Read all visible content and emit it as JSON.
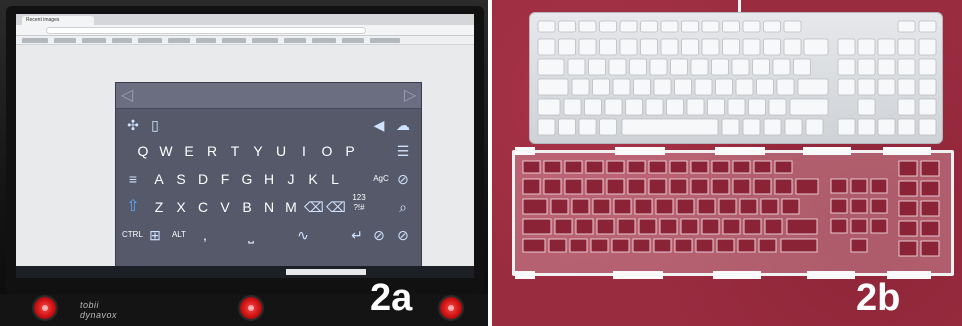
{
  "panels": [
    {
      "label": "2a",
      "browser": {
        "tab_title": "Recent images"
      },
      "keyboard": {
        "rows": [
          [
            "Q",
            "W",
            "E",
            "R",
            "T",
            "Y",
            "U",
            "I",
            "O",
            "P"
          ],
          [
            "A",
            "S",
            "D",
            "F",
            "G",
            "H",
            "J",
            "K",
            "L"
          ],
          [
            "Z",
            "X",
            "C",
            "V",
            "B",
            "N",
            "M"
          ]
        ],
        "small_labels": {
          "num": "123",
          "sym": "?!#",
          "ctrl": "CTRL",
          "alt": "ALT",
          "comma": ",",
          "case": "AgC"
        }
      },
      "brand": "tobii dynavox"
    },
    {
      "label": "2b"
    }
  ]
}
